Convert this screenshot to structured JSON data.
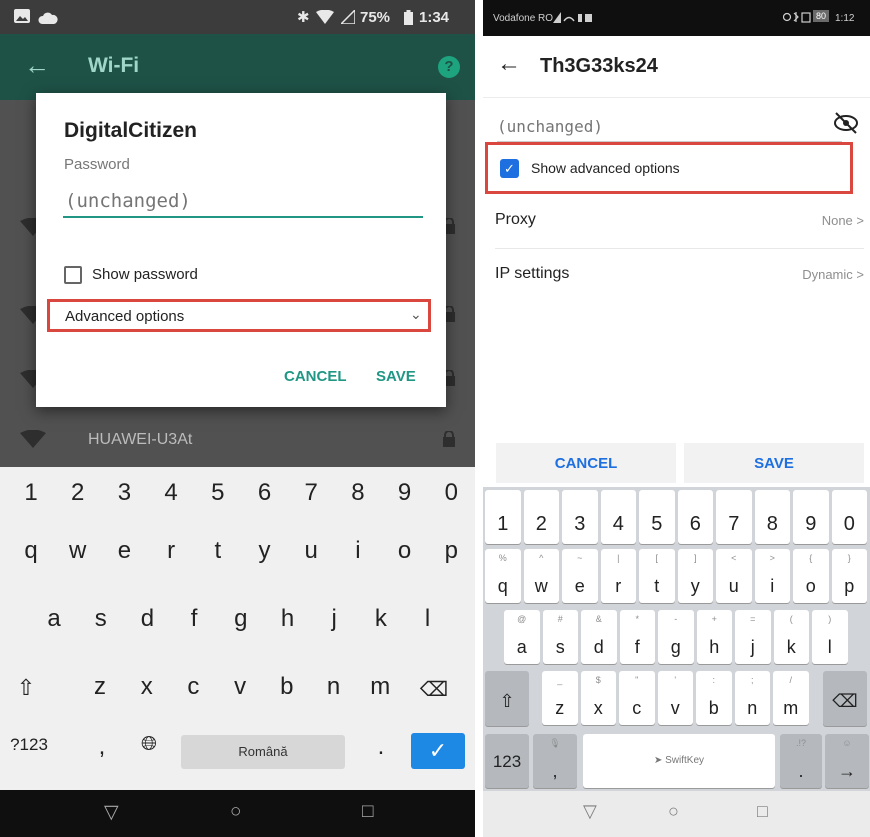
{
  "left": {
    "status": {
      "percent": "75%",
      "time": "1:34"
    },
    "appbar": {
      "title": "Wi-Fi",
      "help": "?"
    },
    "networks": [
      {
        "name": "HUAWEI-U3At"
      }
    ],
    "dialog": {
      "title": "DigitalCitizen",
      "password_label": "Password",
      "password_placeholder": "(unchanged)",
      "show_password": "Show password",
      "advanced": "Advanced options",
      "cancel": "CANCEL",
      "save": "SAVE"
    },
    "keyboard": {
      "numbers": [
        "1",
        "2",
        "3",
        "4",
        "5",
        "6",
        "7",
        "8",
        "9",
        "0"
      ],
      "row1": [
        "q",
        "w",
        "e",
        "r",
        "t",
        "y",
        "u",
        "i",
        "o",
        "p"
      ],
      "row2": [
        "a",
        "s",
        "d",
        "f",
        "g",
        "h",
        "j",
        "k",
        "l"
      ],
      "row3": [
        "z",
        "x",
        "c",
        "v",
        "b",
        "n",
        "m"
      ],
      "symbols": "?123",
      "comma": ",",
      "space": "Română",
      "period": "."
    }
  },
  "right": {
    "status": {
      "carrier": "Vodafone RO",
      "battery": "80",
      "time": "1:12"
    },
    "appbar": {
      "title": "Th3G33ks24"
    },
    "password_placeholder": "(unchanged)",
    "show_advanced": "Show advanced options",
    "proxy": {
      "label": "Proxy",
      "value": "None"
    },
    "ip": {
      "label": "IP settings",
      "value": "Dynamic"
    },
    "cancel": "CANCEL",
    "save": "SAVE",
    "keyboard": {
      "numbers": [
        "1",
        "2",
        "3",
        "4",
        "5",
        "6",
        "7",
        "8",
        "9",
        "0"
      ],
      "row1": [
        [
          "%",
          "q"
        ],
        [
          "^",
          "w"
        ],
        [
          "~",
          "e"
        ],
        [
          "|",
          "r"
        ],
        [
          "[",
          "t"
        ],
        [
          "]",
          "y"
        ],
        [
          "<",
          "u"
        ],
        [
          ">",
          "i"
        ],
        [
          "{",
          "o"
        ],
        [
          "}",
          "p"
        ]
      ],
      "row2": [
        [
          "@",
          "a"
        ],
        [
          "#",
          "s"
        ],
        [
          "&",
          "d"
        ],
        [
          "*",
          "f"
        ],
        [
          "-",
          "g"
        ],
        [
          "+",
          "h"
        ],
        [
          "=",
          "j"
        ],
        [
          "(",
          "k"
        ],
        [
          ")",
          "l"
        ]
      ],
      "row3": [
        [
          "_",
          "z"
        ],
        [
          "$",
          "x"
        ],
        [
          "\"",
          "c"
        ],
        [
          "'",
          "v"
        ],
        [
          ":",
          "b"
        ],
        [
          ";",
          "n"
        ],
        [
          "/",
          "m"
        ]
      ],
      "symbols": "123",
      "comma": ",",
      "space": "SwiftKey",
      "period": ".",
      "period_hint": ".!?"
    }
  },
  "colors": {
    "accent_teal": "#209784",
    "highlight_red": "#d9473e",
    "accent_blue": "#1e6fe0"
  }
}
